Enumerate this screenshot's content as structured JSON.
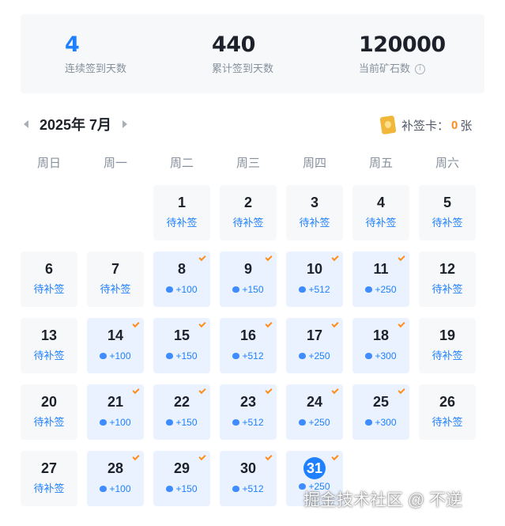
{
  "stats": {
    "continuous_days": "4",
    "continuous_label": "连续签到天数",
    "total_days": "440",
    "total_label": "累计签到天数",
    "ore": "120000",
    "ore_label": "当前矿石数",
    "info_icon": "info-icon"
  },
  "calendar": {
    "month_title": "2025年 7月",
    "card_label": "补签卡：",
    "card_count": "0",
    "card_unit": "张",
    "weekdays": [
      "周日",
      "周一",
      "周二",
      "周三",
      "周四",
      "周五",
      "周六"
    ],
    "days": [
      {
        "day": "1",
        "status": "待补签"
      },
      {
        "day": "2",
        "status": "待补签"
      },
      {
        "day": "3",
        "status": "待补签"
      },
      {
        "day": "4",
        "status": "待补签"
      },
      {
        "day": "5",
        "status": "待补签"
      },
      {
        "day": "6",
        "status": "待补签"
      },
      {
        "day": "7",
        "status": "待补签"
      },
      {
        "day": "8",
        "reward": "+100"
      },
      {
        "day": "9",
        "reward": "+150"
      },
      {
        "day": "10",
        "reward": "+512"
      },
      {
        "day": "11",
        "reward": "+250"
      },
      {
        "day": "12",
        "status": "待补签"
      },
      {
        "day": "13",
        "status": "待补签"
      },
      {
        "day": "14",
        "reward": "+100"
      },
      {
        "day": "15",
        "reward": "+150"
      },
      {
        "day": "16",
        "reward": "+512"
      },
      {
        "day": "17",
        "reward": "+250"
      },
      {
        "day": "18",
        "reward": "+300"
      },
      {
        "day": "19",
        "status": "待补签"
      },
      {
        "day": "20",
        "status": "待补签"
      },
      {
        "day": "21",
        "reward": "+100"
      },
      {
        "day": "22",
        "reward": "+150"
      },
      {
        "day": "23",
        "reward": "+512"
      },
      {
        "day": "24",
        "reward": "+250"
      },
      {
        "day": "25",
        "reward": "+300"
      },
      {
        "day": "26",
        "status": "待补签"
      },
      {
        "day": "27",
        "status": "待补签"
      },
      {
        "day": "28",
        "reward": "+100"
      },
      {
        "day": "29",
        "reward": "+150"
      },
      {
        "day": "30",
        "reward": "+512"
      },
      {
        "day": "31",
        "reward": "+250",
        "today": true
      }
    ]
  },
  "watermark": "掘金技术社区 @ 不逆",
  "colors": {
    "accent": "#1e80ff",
    "signed_bg": "#eaf2ff",
    "pending_bg": "#f7f8fa",
    "check": "#ff8d1a"
  }
}
